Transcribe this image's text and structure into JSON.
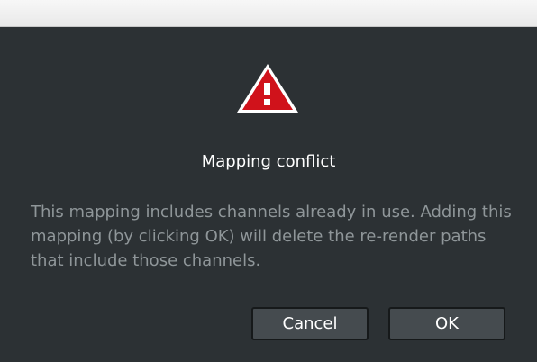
{
  "dialog": {
    "icon": "warning-icon",
    "title": "Mapping conflict",
    "message": "This mapping includes channels already in use. Adding this mapping (by clicking OK) will delete the re-render paths that include those channels.",
    "buttons": {
      "cancel_label": "Cancel",
      "ok_label": "OK"
    }
  },
  "colors": {
    "background": "#2c3134",
    "warning_red": "#d0121b",
    "button_bg": "#454b4f",
    "message_text": "#8f9699"
  }
}
